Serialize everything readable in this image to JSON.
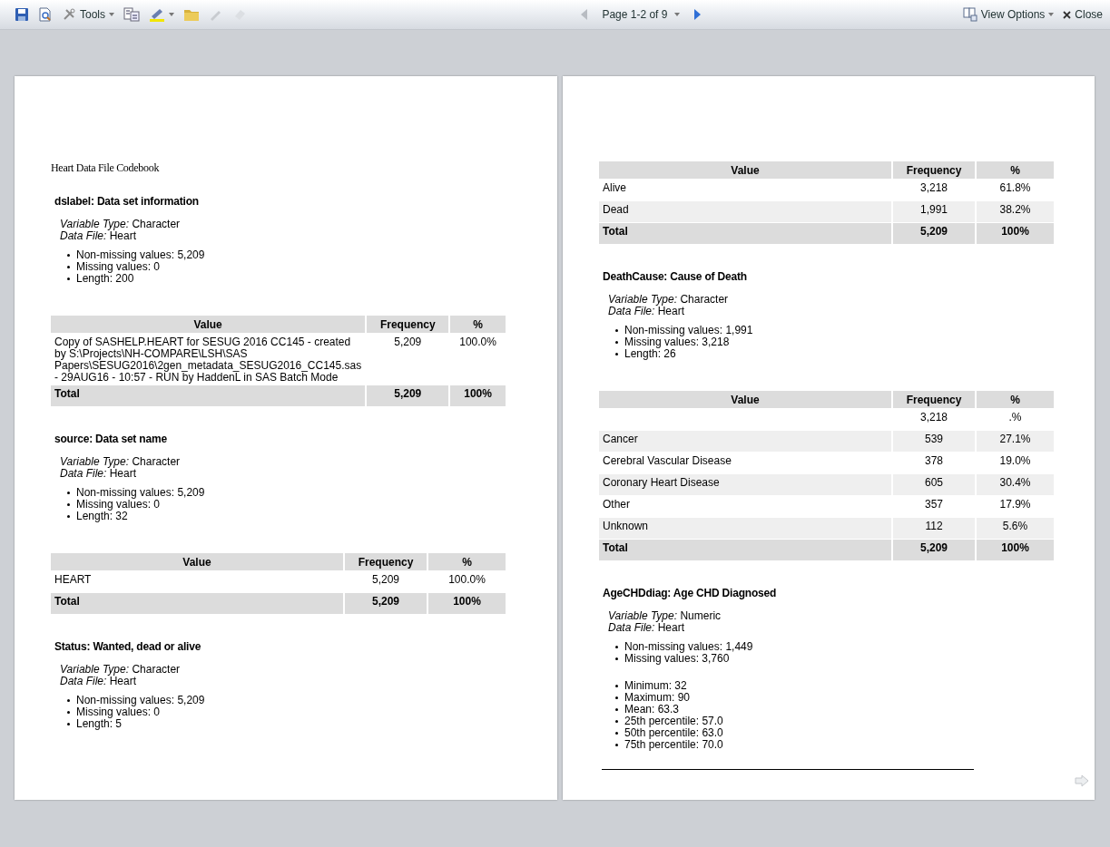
{
  "toolbar": {
    "tools_label": "Tools",
    "page_label": "Page 1-2 of 9",
    "prev_disabled": true,
    "next_disabled": false,
    "view_options": "View Options",
    "close": "Close"
  },
  "pages": [
    {
      "blocks": [
        {
          "kind": "title",
          "text": "Heart Data File Codebook"
        },
        {
          "kind": "variable",
          "heading": "dslabel: Data set information",
          "type_label": "Variable Type:",
          "type_value": "Character",
          "file_label": "Data File:",
          "file_value": "Heart",
          "lists": [
            [
              "Non-missing values: 5,209",
              "Missing values: 0",
              "Length: 200"
            ]
          ]
        },
        {
          "kind": "table",
          "columns": [
            "Value",
            "Frequency",
            "%"
          ],
          "rows": [
            [
              "Copy of SASHELP.HEART for SESUG 2016 CC145 - created by S:\\Projects\\NH-COMPARE\\LSH\\SAS Papers\\SESUG2016\\2gen_metadata_SESUG2016_CC145.sas - 29AUG16 - 10:57 - RUN by HaddenL in SAS Batch Mode",
              "5,209",
              "100.0%"
            ]
          ],
          "total": [
            "Total",
            "5,209",
            "100%"
          ]
        },
        {
          "kind": "variable",
          "heading": "source: Data set name",
          "type_label": "Variable Type:",
          "type_value": "Character",
          "file_label": "Data File:",
          "file_value": "Heart",
          "lists": [
            [
              "Non-missing values: 5,209",
              "Missing values: 0",
              "Length: 32"
            ]
          ]
        },
        {
          "kind": "table",
          "columns": [
            "Value",
            "Frequency",
            "%"
          ],
          "rows": [
            [
              "HEART",
              "5,209",
              "100.0%"
            ]
          ],
          "total": [
            "Total",
            "5,209",
            "100%"
          ]
        },
        {
          "kind": "variable",
          "heading": "Status: Wanted, dead or alive",
          "type_label": "Variable Type:",
          "type_value": "Character",
          "file_label": "Data File:",
          "file_value": "Heart",
          "lists": [
            [
              "Non-missing values: 5,209",
              "Missing values: 0",
              "Length: 5"
            ]
          ]
        }
      ]
    },
    {
      "blocks": [
        {
          "kind": "table",
          "columns": [
            "Value",
            "Frequency",
            "%"
          ],
          "rows": [
            [
              "Alive",
              "3,218",
              "61.8%"
            ],
            [
              "Dead",
              "1,991",
              "38.2%"
            ]
          ],
          "total": [
            "Total",
            "5,209",
            "100%"
          ]
        },
        {
          "kind": "variable",
          "heading": "DeathCause: Cause of Death",
          "type_label": "Variable Type:",
          "type_value": "Character",
          "file_label": "Data File:",
          "file_value": "Heart",
          "lists": [
            [
              "Non-missing values: 1,991",
              "Missing values: 3,218",
              "Length: 26"
            ]
          ]
        },
        {
          "kind": "table",
          "columns": [
            "Value",
            "Frequency",
            "%"
          ],
          "rows": [
            [
              null,
              "3,218",
              ".%"
            ],
            [
              "Cancer",
              "539",
              "27.1%"
            ],
            [
              "Cerebral Vascular Disease",
              "378",
              "19.0%"
            ],
            [
              "Coronary Heart Disease",
              "605",
              "30.4%"
            ],
            [
              "Other",
              "357",
              "17.9%"
            ],
            [
              "Unknown",
              "112",
              "5.6%"
            ]
          ],
          "total": [
            "Total",
            "5,209",
            "100%"
          ]
        },
        {
          "kind": "variable",
          "heading": "AgeCHDdiag: Age CHD Diagnosed",
          "type_label": "Variable Type:",
          "type_value": "Numeric",
          "file_label": "Data File:",
          "file_value": "Heart",
          "lists": [
            [
              "Non-missing values: 1,449",
              "Missing values: 3,760"
            ],
            [
              "Minimum: 32",
              "Maximum: 90",
              "Mean: 63.3",
              "25th percentile: 57.0",
              "50th percentile: 63.0",
              "75th percentile: 70.0"
            ]
          ]
        },
        {
          "kind": "rule"
        }
      ]
    }
  ]
}
